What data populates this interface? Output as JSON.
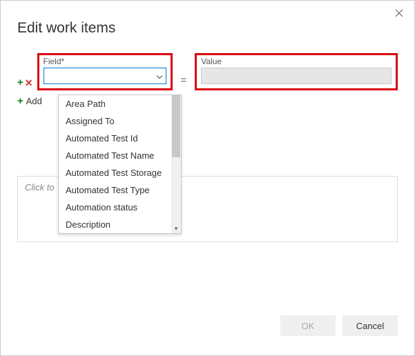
{
  "dialog": {
    "title": "Edit work items",
    "close_icon": "close"
  },
  "row": {
    "field_label": "Field*",
    "field_value": "",
    "equals": "=",
    "value_label": "Value",
    "value_value": ""
  },
  "add_row": {
    "label": "Add new clause"
  },
  "dropdown": {
    "items": [
      "Area Path",
      "Assigned To",
      "Automated Test Id",
      "Automated Test Name",
      "Automated Test Storage",
      "Automated Test Type",
      "Automation status",
      "Description"
    ]
  },
  "notes": {
    "placeholder": "Click to add notes to the work item history"
  },
  "buttons": {
    "ok": "OK",
    "cancel": "Cancel"
  }
}
